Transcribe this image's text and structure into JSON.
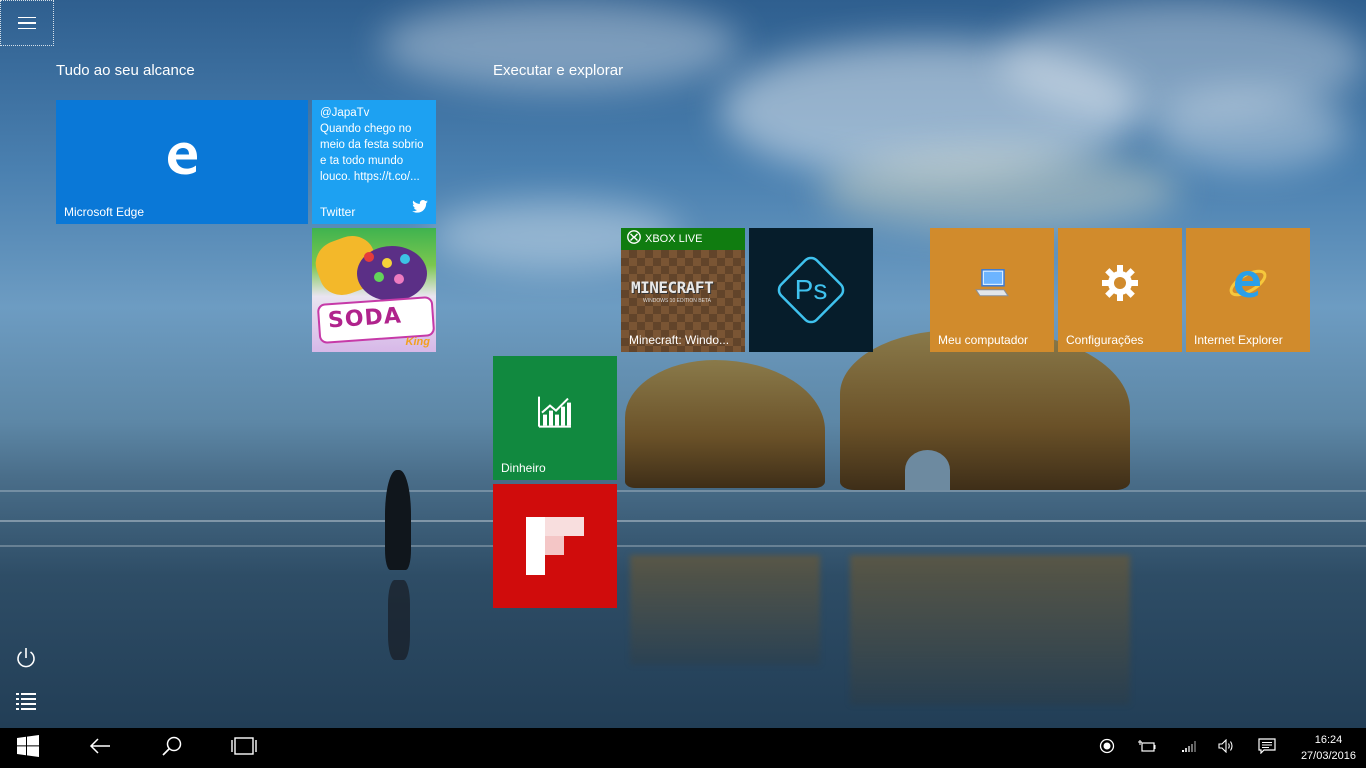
{
  "start_menu": {
    "groups": [
      {
        "title": "Tudo ao seu alcance"
      },
      {
        "title": "Executar e explorar"
      }
    ],
    "tiles": {
      "edge": {
        "label": "Microsoft Edge",
        "color": "#0a78d7"
      },
      "twitter": {
        "label": "Twitter",
        "handle": "@JapaTv",
        "tweet": "Quando chego no meio da festa sobrio e ta todo mundo louco. https://t.co/...",
        "color": "#1da1f2"
      },
      "candy_crush": {
        "logo_text": "SODA",
        "sub_text": "King"
      },
      "minecraft": {
        "label": "Minecraft: Windo...",
        "badge": "XBOX LIVE",
        "logo": "MINECRAFT",
        "edition": "WINDOWS 10 EDITION BETA"
      },
      "photoshop": {
        "logo": "Ps"
      },
      "meu_computador": {
        "label": "Meu computador",
        "color": "#d18b2c"
      },
      "configuracoes": {
        "label": "Configurações",
        "color": "#d18b2c"
      },
      "internet_explorer": {
        "label": "Internet Explorer",
        "color": "#d18b2c"
      },
      "dinheiro": {
        "label": "Dinheiro",
        "color": "#11893f"
      },
      "flipboard": {
        "color": "#d00c0c"
      }
    }
  },
  "left_rail": {
    "icons": [
      "power-icon",
      "all-apps-list-icon"
    ]
  },
  "taskbar": {
    "buttons": [
      "windows-start-icon",
      "back-arrow-icon",
      "search-icon",
      "task-view-icon"
    ],
    "tray": [
      "record-icon",
      "battery-icon",
      "wifi-icon",
      "volume-icon",
      "action-center-icon"
    ],
    "time": "16:24",
    "date": "27/03/2016"
  }
}
